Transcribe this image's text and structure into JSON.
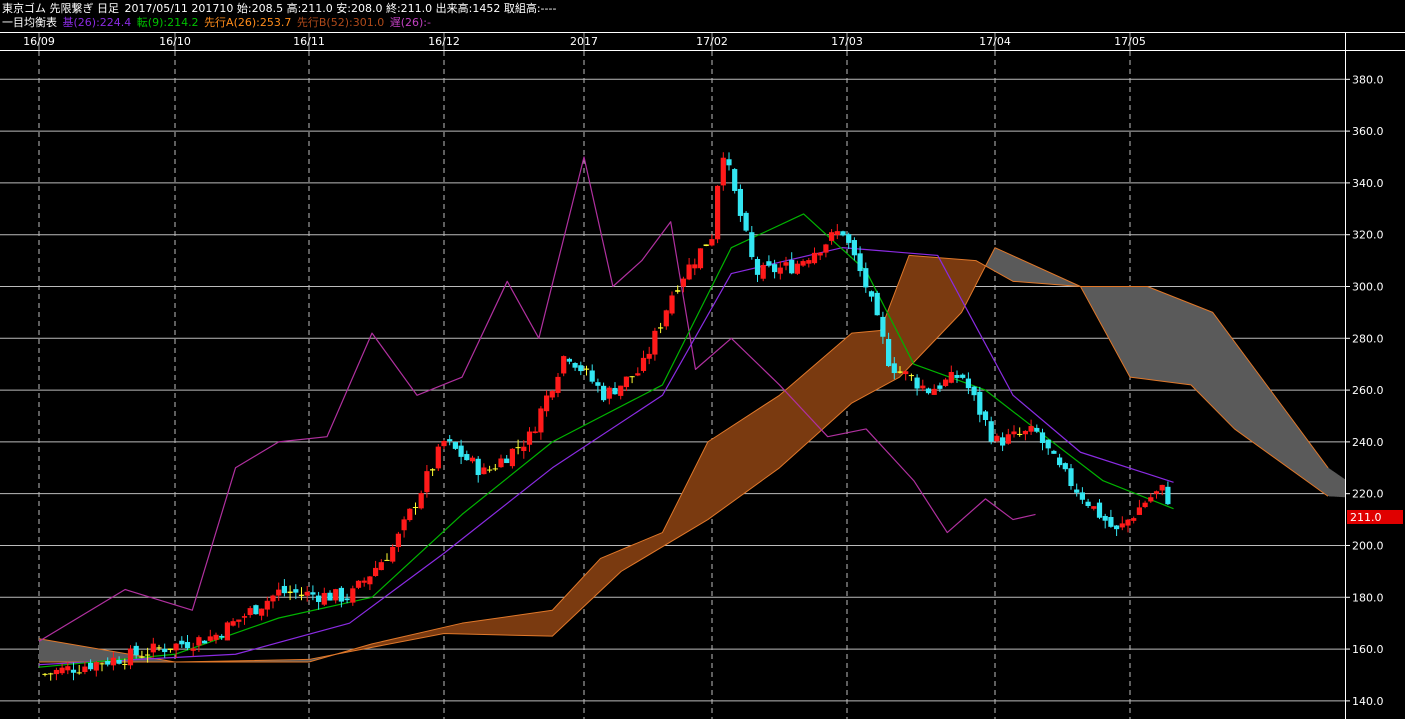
{
  "header": {
    "instrument": "東京ゴム 先限繋ぎ 日足",
    "ohlc": "2017/05/11 201710 始:208.5 高:211.0 安:208.0 終:211.0 出来高:1452 取組高:----",
    "indicator_name": "一目均衡表",
    "kijun": "基(26):224.4",
    "tenkan": "転(9):214.2",
    "senkou_a": "先行A(26):253.7",
    "senkou_b": "先行B(52):301.0",
    "chikou": "遅(26):-"
  },
  "colors": {
    "background": "#000000",
    "grid": "#bbbbbb",
    "up_candle": "#ff1a1a",
    "down_candle": "#33e6f2",
    "doji": "#ffff33",
    "tenkan": "#00b400",
    "kijun": "#8a2be2",
    "chikou": "#b0309f",
    "cloud_bull": "#7a3a10",
    "cloud_bear": "#5a5a5a",
    "cloud_edge": "#e0782a",
    "last_price_bg": "#e00000",
    "kijun_label": "#8a2be2",
    "tenkan_label": "#00c000",
    "senkou_a_label": "#ff8c1a",
    "senkou_b_label": "#b04a1a",
    "chikou_label": "#c040c0"
  },
  "chart_data": {
    "type": "candlestick",
    "x_labels": [
      "16/09",
      "16/10",
      "16/11",
      "16/12",
      "2017",
      "17/02",
      "17/03",
      "17/04",
      "17/05"
    ],
    "y_ticks": [
      140,
      160,
      180,
      200,
      220,
      240,
      260,
      280,
      300,
      320,
      340,
      360,
      380
    ],
    "y_tick_labels": [
      "140.0",
      "160.0",
      "180.0",
      "200.0",
      "220.0",
      "240.0",
      "260.0",
      "280.0",
      "300.0",
      "320.0",
      "340.0",
      "360.0",
      "380.0"
    ],
    "ylim": [
      133,
      389
    ],
    "last_price_label": "211.0",
    "last_price": 211.0,
    "anchors": [
      {
        "date": "2016/09",
        "price": 150
      },
      {
        "date": "2016/09/20",
        "price": 157
      },
      {
        "date": "2016/10/10",
        "price": 165
      },
      {
        "date": "2016/10/25",
        "price": 182
      },
      {
        "date": "2016/11/10",
        "price": 180
      },
      {
        "date": "2016/11/20",
        "price": 200
      },
      {
        "date": "2016/12/01",
        "price": 240
      },
      {
        "date": "2016/12/10",
        "price": 228
      },
      {
        "date": "2016/12/20",
        "price": 242
      },
      {
        "date": "2016/12/28",
        "price": 275
      },
      {
        "date": "2017/01/06",
        "price": 258
      },
      {
        "date": "2017/01/15",
        "price": 268
      },
      {
        "date": "2017/01/23",
        "price": 300
      },
      {
        "date": "2017/02/01",
        "price": 320
      },
      {
        "date": "2017/02/03",
        "price": 355
      },
      {
        "date": "2017/02/10",
        "price": 305
      },
      {
        "date": "2017/02/18",
        "price": 308
      },
      {
        "date": "2017/02/28",
        "price": 322
      },
      {
        "date": "2017/03/05",
        "price": 300
      },
      {
        "date": "2017/03/10",
        "price": 270
      },
      {
        "date": "2017/03/18",
        "price": 260
      },
      {
        "date": "2017/03/25",
        "price": 266
      },
      {
        "date": "2017/04/01",
        "price": 240
      },
      {
        "date": "2017/04/10",
        "price": 244
      },
      {
        "date": "2017/04/15",
        "price": 230
      },
      {
        "date": "2017/04/20",
        "price": 220
      },
      {
        "date": "2017/04/28",
        "price": 205
      },
      {
        "date": "2017/05/05",
        "price": 218
      },
      {
        "date": "2017/05/09",
        "price": 222
      },
      {
        "date": "2017/05/11",
        "price": 211
      }
    ],
    "tenkan": [
      {
        "date": "2016/09",
        "price": 153
      },
      {
        "date": "2016/10",
        "price": 158
      },
      {
        "date": "2016/10/25",
        "price": 172
      },
      {
        "date": "2016/11/15",
        "price": 180
      },
      {
        "date": "2016/12/05",
        "price": 212
      },
      {
        "date": "2016/12/25",
        "price": 240
      },
      {
        "date": "2017/01/20",
        "price": 262
      },
      {
        "date": "2017/02/05",
        "price": 315
      },
      {
        "date": "2017/02/20",
        "price": 328
      },
      {
        "date": "2017/03/05",
        "price": 306
      },
      {
        "date": "2017/03/15",
        "price": 270
      },
      {
        "date": "2017/03/30",
        "price": 260
      },
      {
        "date": "2017/04/10",
        "price": 245
      },
      {
        "date": "2017/04/25",
        "price": 225
      },
      {
        "date": "2017/05/11",
        "price": 214.2
      }
    ],
    "kijun": [
      {
        "date": "2016/09",
        "price": 154
      },
      {
        "date": "2016/10/15",
        "price": 158
      },
      {
        "date": "2016/11/10",
        "price": 170
      },
      {
        "date": "2016/12/01",
        "price": 197
      },
      {
        "date": "2016/12/25",
        "price": 230
      },
      {
        "date": "2017/01/20",
        "price": 258
      },
      {
        "date": "2017/02/05",
        "price": 305
      },
      {
        "date": "2017/02/28",
        "price": 315
      },
      {
        "date": "2017/03/20",
        "price": 312
      },
      {
        "date": "2017/04/05",
        "price": 258
      },
      {
        "date": "2017/04/20",
        "price": 236
      },
      {
        "date": "2017/05/11",
        "price": 224.4
      }
    ],
    "chikou": [
      {
        "date": "2016/09",
        "price": 163
      },
      {
        "date": "2016/09/20",
        "price": 183
      },
      {
        "date": "2016/10/05",
        "price": 175
      },
      {
        "date": "2016/10/15",
        "price": 230
      },
      {
        "date": "2016/10/25",
        "price": 240
      },
      {
        "date": "2016/11/05",
        "price": 242
      },
      {
        "date": "2016/11/15",
        "price": 282
      },
      {
        "date": "2016/11/25",
        "price": 258
      },
      {
        "date": "2016/12/05",
        "price": 265
      },
      {
        "date": "2016/12/15",
        "price": 302
      },
      {
        "date": "2016/12/22",
        "price": 280
      },
      {
        "date": "2017/01/01",
        "price": 350
      },
      {
        "date": "2017/01/08",
        "price": 300
      },
      {
        "date": "2017/01/15",
        "price": 310
      },
      {
        "date": "2017/01/22",
        "price": 325
      },
      {
        "date": "2017/01/28",
        "price": 268
      },
      {
        "date": "2017/02/05",
        "price": 280
      },
      {
        "date": "2017/02/15",
        "price": 262
      },
      {
        "date": "2017/02/25",
        "price": 242
      },
      {
        "date": "2017/03/05",
        "price": 245
      },
      {
        "date": "2017/03/15",
        "price": 225
      },
      {
        "date": "2017/03/22",
        "price": 205
      },
      {
        "date": "2017/03/30",
        "price": 218
      },
      {
        "date": "2017/04/05",
        "price": 210
      },
      {
        "date": "2017/04/10",
        "price": 212
      }
    ],
    "senkou_a": [
      {
        "date": "2016/09",
        "price": 155
      },
      {
        "date": "2016/10",
        "price": 155
      },
      {
        "date": "2016/11",
        "price": 155
      },
      {
        "date": "2016/11/15",
        "price": 162
      },
      {
        "date": "2016/12/05",
        "price": 170
      },
      {
        "date": "2016/12/25",
        "price": 175
      },
      {
        "date": "2017/01/05",
        "price": 195
      },
      {
        "date": "2017/01/20",
        "price": 205
      },
      {
        "date": "2017/01/31",
        "price": 240
      },
      {
        "date": "2017/02/15",
        "price": 258
      },
      {
        "date": "2017/03/02",
        "price": 282
      },
      {
        "date": "2017/03/08",
        "price": 283
      },
      {
        "date": "2017/03/14",
        "price": 312
      },
      {
        "date": "2017/03/28",
        "price": 310
      },
      {
        "date": "2017/04/05",
        "price": 302
      },
      {
        "date": "2017/04/20",
        "price": 300
      },
      {
        "date": "2017/05/01",
        "price": 265
      },
      {
        "date": "2017/05/15",
        "price": 262
      },
      {
        "date": "2017/05/25",
        "price": 245
      },
      {
        "date": "2017/06/15",
        "price": 219
      },
      {
        "date": "2017/06/25",
        "price": 218
      }
    ],
    "senkou_b": [
      {
        "date": "2016/09",
        "price": 164
      },
      {
        "date": "2016/10",
        "price": 155
      },
      {
        "date": "2016/11",
        "price": 156
      },
      {
        "date": "2016/12",
        "price": 166
      },
      {
        "date": "2016/12/25",
        "price": 165
      },
      {
        "date": "2017/01/10",
        "price": 190
      },
      {
        "date": "2017/01/31",
        "price": 210
      },
      {
        "date": "2017/02/15",
        "price": 230
      },
      {
        "date": "2017/03/02",
        "price": 255
      },
      {
        "date": "2017/03/12",
        "price": 265
      },
      {
        "date": "2017/03/25",
        "price": 290
      },
      {
        "date": "2017/04/01",
        "price": 315
      },
      {
        "date": "2017/04/20",
        "price": 300
      },
      {
        "date": "2017/05/05",
        "price": 300
      },
      {
        "date": "2017/05/20",
        "price": 290
      },
      {
        "date": "2017/06/15",
        "price": 230
      },
      {
        "date": "2017/06/25",
        "price": 218
      }
    ]
  }
}
